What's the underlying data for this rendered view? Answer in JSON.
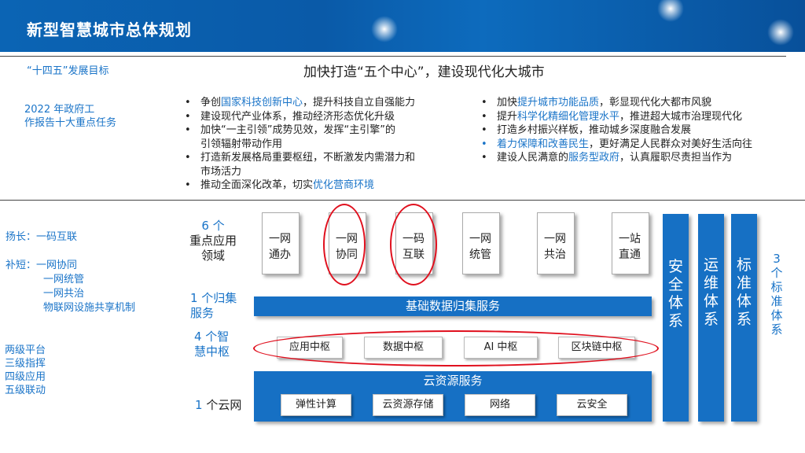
{
  "header": {
    "title": "新型智慧城市总体规划"
  },
  "goals": {
    "label": "“十四五”发展目标",
    "main": "加快打造“五个中心”，建设现代化大城市"
  },
  "tasks": {
    "label_line1": "2022 年政府工",
    "label_line2": "作报告十大重点任务",
    "left": [
      {
        "pre": "争创",
        "hl": "国家科技创新中心",
        "post": "，提升科技自立自强能力"
      },
      {
        "pre": "建设现代产业体系，推动经济形态优化升级",
        "hl": "",
        "post": ""
      },
      {
        "pre": "加快“一主引领”成势见效，发挥“主引擎”的",
        "hl": "",
        "post": "",
        "cont": "引领辐射带动作用"
      },
      {
        "pre": "打造新发展格局重要枢纽，不断激发内需潜力和",
        "hl": "",
        "post": "",
        "cont": "市场活力"
      },
      {
        "pre": "推动全面深化改革，切实",
        "hl": "优化营商环境",
        "post": ""
      }
    ],
    "right": [
      {
        "pre": "加快",
        "hl": "提升城市功能品质",
        "post": "，彰显现代化大都市风貌"
      },
      {
        "pre": "提升",
        "hl": "科学化精细化管理水平",
        "post": "，推进超大城市治理现代化"
      },
      {
        "pre": "打造乡村振兴样板，推动城乡深度融合发展",
        "hl": "",
        "post": ""
      },
      {
        "pre": "",
        "hl": "着力保障和改善民生",
        "post": "，更好满足人民群众对美好生活向往"
      },
      {
        "pre": "建设人民满意的",
        "hl": "服务型政府",
        "post": "，认真履职尽责担当作为"
      }
    ]
  },
  "side": {
    "yangchang": "扬长：一码互联",
    "buduan_1": "补短：一网协同",
    "buduan_2": "一网统管",
    "buduan_3": "一网共治",
    "buduan_4": "物联网设施共享机制",
    "two_1": "两级平台",
    "two_2": "三级指挥",
    "two_3": "四级应用",
    "two_4": "五级联动"
  },
  "labels": {
    "apps_num": "6 个",
    "apps_line1": "重点应用",
    "apps_line2": "领域",
    "collect_num": "1 个归集",
    "collect_line2": "服务",
    "hub_num": "4 个智",
    "hub_line2": "慧中枢",
    "cloud_num": "1",
    "cloud_text": " 个云网",
    "systems_num": "3",
    "systems_text": "个标准体系"
  },
  "apps": [
    {
      "l1": "一网",
      "l2": "通办"
    },
    {
      "l1": "一网",
      "l2": "协同"
    },
    {
      "l1": "一码",
      "l2": "互联"
    },
    {
      "l1": "一网",
      "l2": "统管"
    },
    {
      "l1": "一网",
      "l2": "共治"
    },
    {
      "l1": "一站",
      "l2": "直通"
    }
  ],
  "data_service": "基础数据归集服务",
  "hubs": [
    "应用中枢",
    "数据中枢",
    "AI 中枢",
    "区块链中枢"
  ],
  "cloud": {
    "title": "云资源服务",
    "items": [
      "弹性计算",
      "云资源存储",
      "网络",
      "云安全"
    ]
  },
  "systems": [
    "安全体系",
    "运维体系",
    "标准体系"
  ],
  "colors": {
    "header_blue": "#0b64b4",
    "accent_blue": "#1a74c8",
    "bar_blue": "#1670c4",
    "oval_red": "#e0101e"
  }
}
